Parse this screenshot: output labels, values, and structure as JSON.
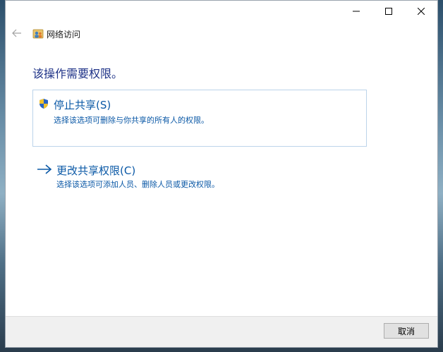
{
  "window": {
    "app_title": "网络访问",
    "controls": {
      "minimize": "minimize-icon",
      "maximize": "maximize-icon",
      "close": "close-icon"
    }
  },
  "main": {
    "heading": "该操作需要权限。",
    "options": [
      {
        "title": "停止共享(S)",
        "description": "选择该选项可删除与你共享的所有人的权限。",
        "icon": "uac-shield-icon"
      },
      {
        "title": "更改共享权限(C)",
        "description": "选择该选项可添加人员、删除人员或更改权限。",
        "icon": "arrow-right-icon"
      }
    ]
  },
  "footer": {
    "cancel_label": "取消"
  },
  "colors": {
    "link": "#0a58a6",
    "heading": "#1e3287",
    "footer": "#f0f0f0"
  }
}
